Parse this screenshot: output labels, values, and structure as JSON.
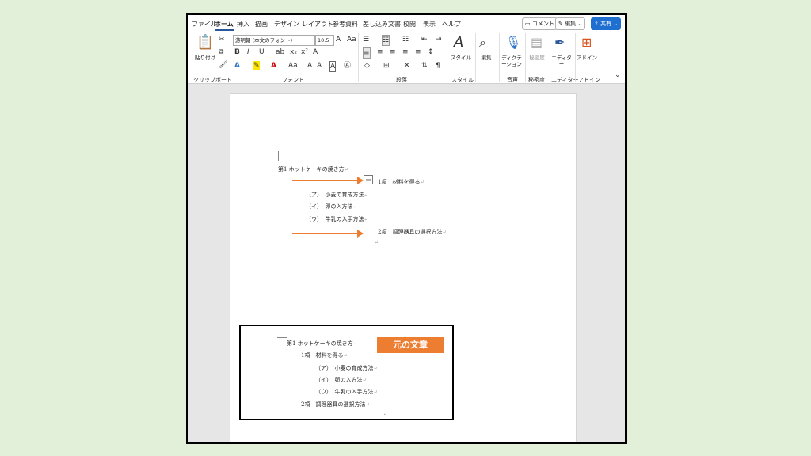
{
  "menu": {
    "tabs": [
      "ファイル",
      "ホーム",
      "挿入",
      "描画",
      "デザイン",
      "レイアウト",
      "参考資料",
      "差し込み文書",
      "校閲",
      "表示",
      "ヘルプ"
    ],
    "comment_label": "コメント",
    "edit_label": "編集",
    "share_label": "共有"
  },
  "ribbon": {
    "paste_label": "貼り付け",
    "font_name": "游明朝 (本文のフォント)",
    "font_size": "10.5",
    "style_label": "スタイル",
    "edit_label": "編集",
    "dictation_label": "ディクテーション",
    "sensitivity_label": "秘密度",
    "editor_label": "エディター",
    "addin_label": "アドイン",
    "groups": {
      "clipboard": "クリップボード",
      "font": "フォント",
      "paragraph": "段落",
      "style": "スタイル",
      "voice": "音声",
      "sensitivity": "秘密度",
      "editor": "エディター",
      "addin": "アドイン"
    }
  },
  "document": {
    "top": {
      "chapter": "第1 ホットケーキの焼き方",
      "item1": "1項　材料を得る",
      "sub_a": "（ア）　小麦の育成方法",
      "sub_i": "（イ）　卵の入方法",
      "sub_u": "（ウ）　牛乳の入手方法",
      "item2": "2項　調理器具の選択方法"
    },
    "original": {
      "badge": "元の文章",
      "chapter": "第1 ホットケーキの焼き方",
      "item1": "1項　材料を得る",
      "sub_a": "（ア）　小麦の育成方法",
      "sub_i": "（イ）　卵の入方法",
      "sub_u": "（ウ）　牛乳の入手方法",
      "item2": "2項　調理器具の選択方法"
    }
  },
  "colors": {
    "accent": "#ed7d31",
    "share": "#1f6fd0",
    "background": "#e2efd9"
  }
}
